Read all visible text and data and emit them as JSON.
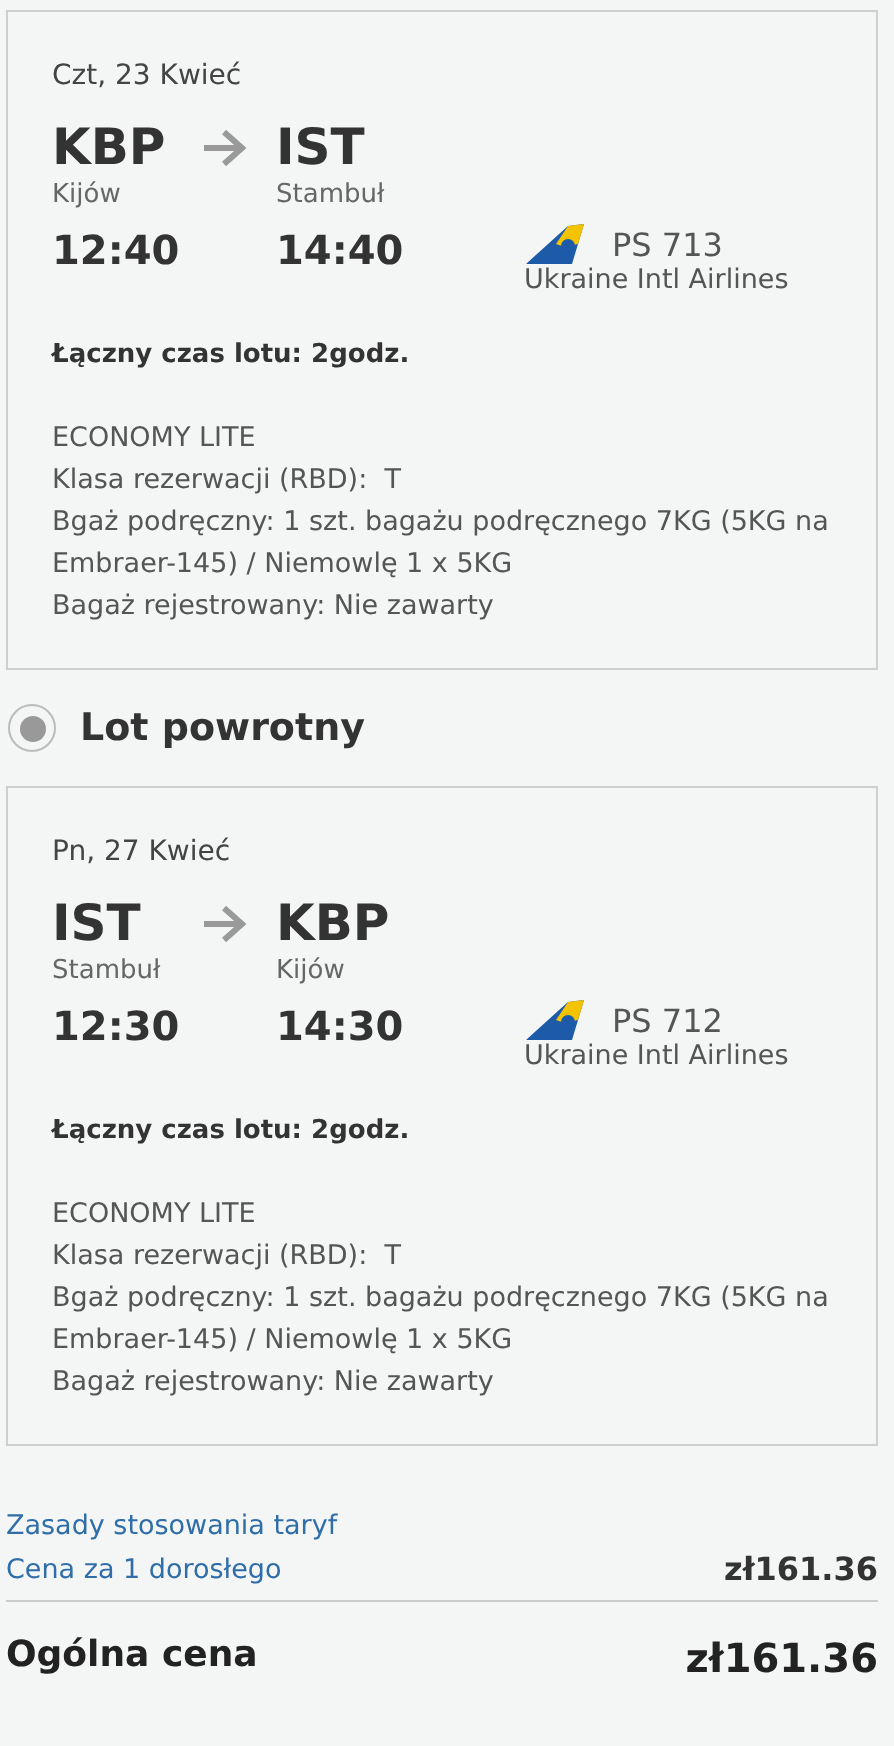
{
  "flights": [
    {
      "date": "Czt, 23 Kwieć",
      "from": {
        "code": "KBP",
        "city": "Kijów",
        "time": "12:40"
      },
      "to": {
        "code": "IST",
        "city": "Stambuł",
        "time": "14:40"
      },
      "flight_number": "PS 713",
      "airline": "Ukraine Intl Airlines",
      "duration": "Łączny czas lotu: 2godz.",
      "details": [
        "ECONOMY LITE",
        "Klasa rezerwacji (RBD):  T",
        "Bgaż podręczny: 1 szt. bagażu podręcznego 7KG (5KG na Embraer-145) / Niemowlę 1 x 5KG",
        "Bagaż rejestrowany: Nie zawarty"
      ]
    },
    {
      "section": {
        "title": "Lot powrotny",
        "selected": true
      },
      "date": "Pn, 27 Kwieć",
      "from": {
        "code": "IST",
        "city": "Stambuł",
        "time": "12:30"
      },
      "to": {
        "code": "KBP",
        "city": "Kijów",
        "time": "14:30"
      },
      "flight_number": "PS 712",
      "airline": "Ukraine Intl Airlines",
      "duration": "Łączny czas lotu: 2godz.",
      "details": [
        "ECONOMY LITE",
        "Klasa rezerwacji (RBD):  T",
        "Bgaż podręczny: 1 szt. bagażu podręcznego 7KG (5KG na Embraer-145) / Niemowlę 1 x 5KG",
        "Bagaż rejestrowany: Nie zawarty"
      ]
    }
  ],
  "fare_rules_link": "Zasady stosowania taryf",
  "per_adult": {
    "label": "Cena za 1 dorosłego",
    "price": "zł161.36"
  },
  "total": {
    "label": "Ogólna cena",
    "price": "zł161.36"
  }
}
